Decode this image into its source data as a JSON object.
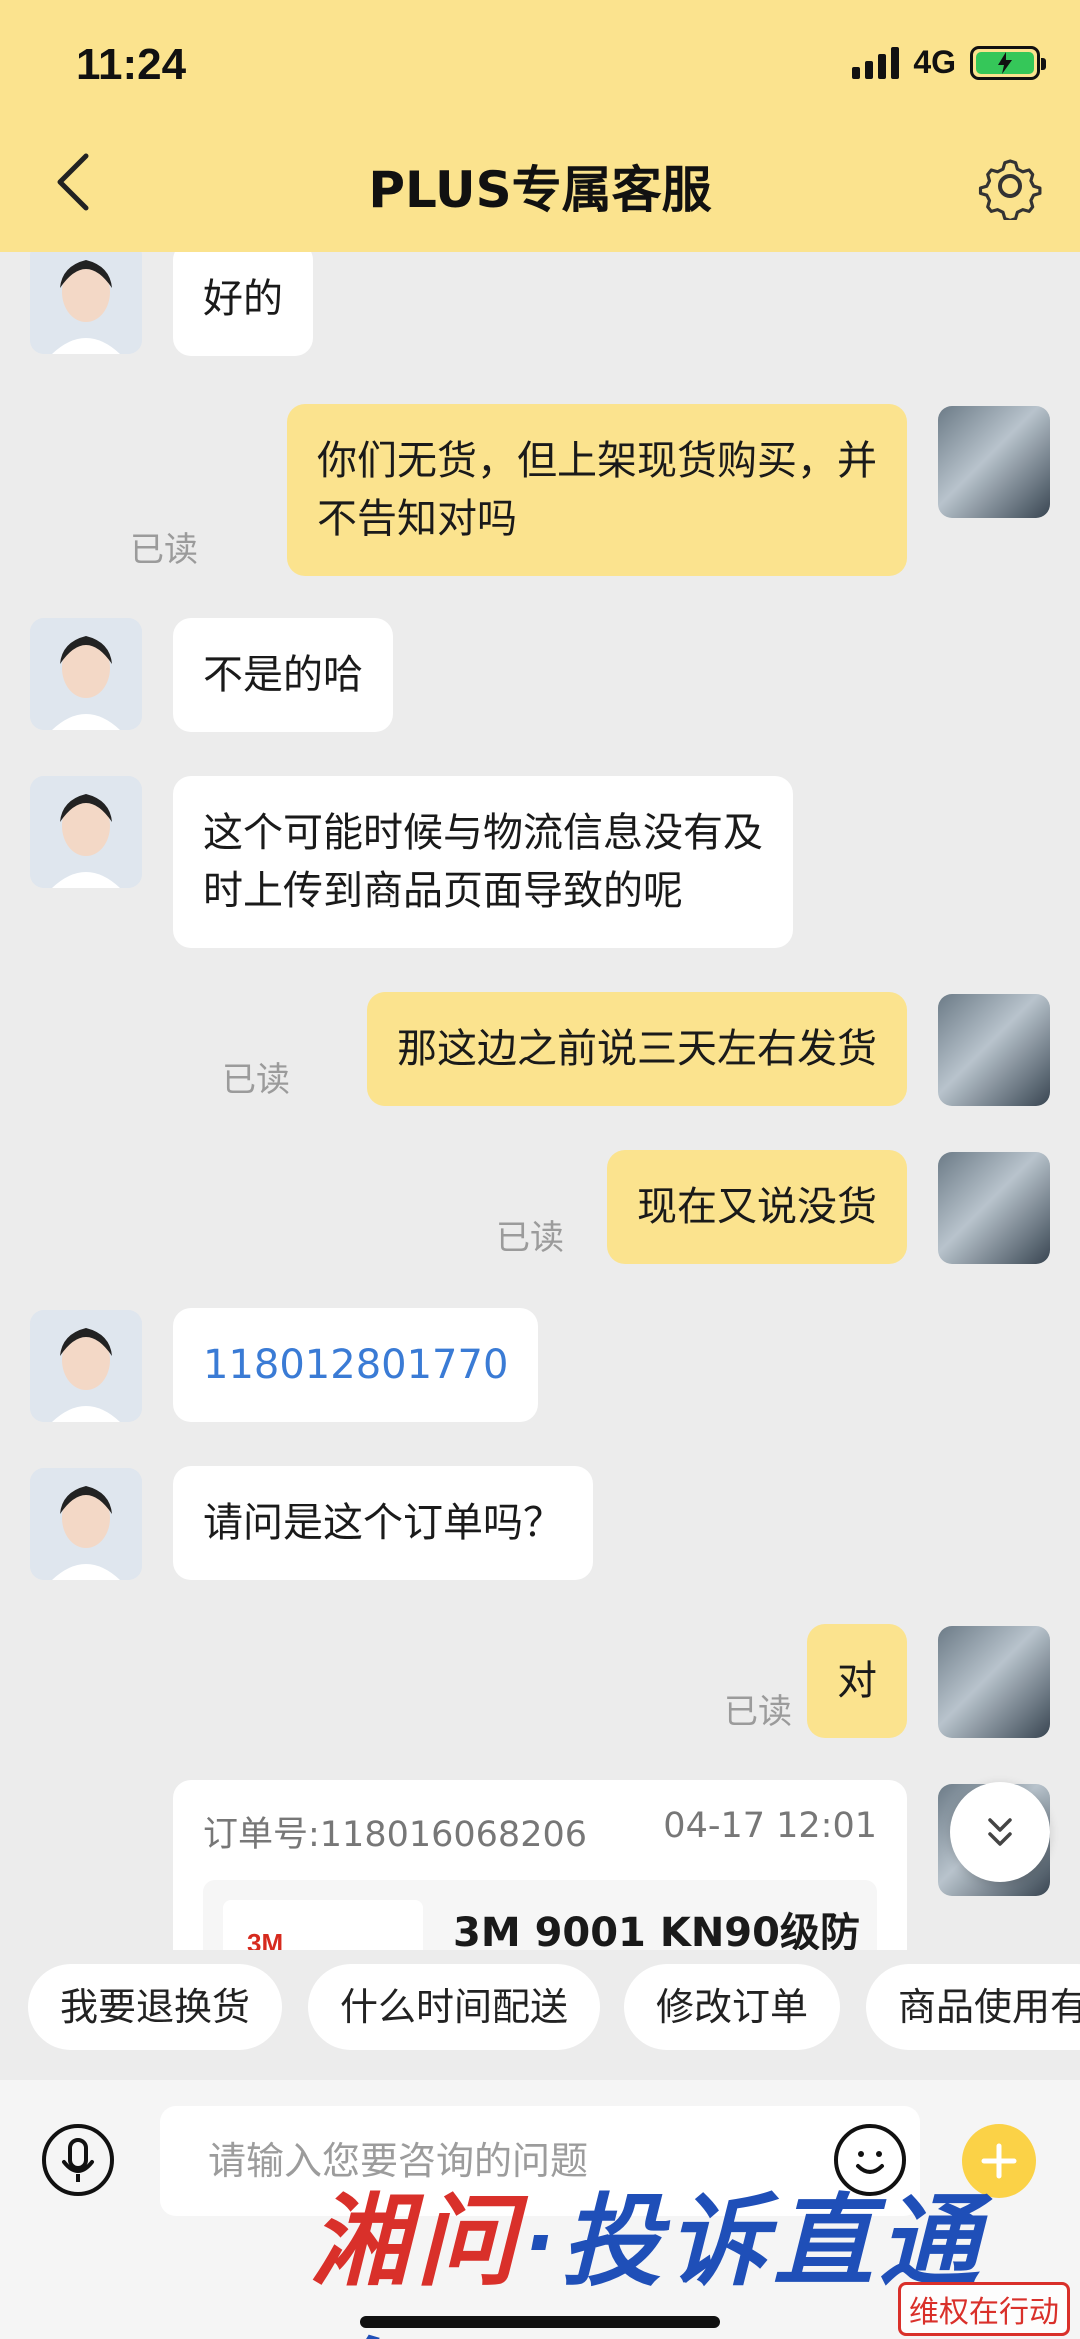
{
  "status_bar": {
    "time": "11:24",
    "network": "4G"
  },
  "header": {
    "title": "PLUS专属客服"
  },
  "messages": [
    {
      "from": "agent",
      "text": "好的"
    },
    {
      "from": "user",
      "lines": [
        "你们无货，但上架现货购买，并",
        "不告知对吗"
      ],
      "status": "已读"
    },
    {
      "from": "agent",
      "text": "不是的哈"
    },
    {
      "from": "agent",
      "lines": [
        "这个可能时候与物流信息没有及",
        "时上传到商品页面导致的呢"
      ]
    },
    {
      "from": "user",
      "text": "那这边之前说三天左右发货",
      "status": "已读"
    },
    {
      "from": "user",
      "text": "现在又说没货",
      "status": "已读"
    },
    {
      "from": "agent",
      "text": "118012801770"
    },
    {
      "from": "agent",
      "text": "请问是这个订单吗？"
    },
    {
      "from": "user",
      "text": "对",
      "status": "已读"
    }
  ],
  "order_card": {
    "order_no": "订单号:118016068206",
    "time": "04-17 12:01",
    "brand": "3M",
    "product_title": "3M 9001 KN90级防"
  },
  "quick_replies": [
    "我要退换货",
    "什么时间配送",
    "修改订单",
    "商品使用有"
  ],
  "input": {
    "placeholder": "请输入您要咨询的问题"
  },
  "watermark": {
    "left": "湘问",
    "right": "·投诉直通车",
    "stamp": "维权在行动"
  },
  "colors": {
    "header_bg": "#fbe38e",
    "user_bubble": "#fbe38e",
    "agent_bubble": "#ffffff",
    "link": "#3a7bd5",
    "plus_button": "#fbd247"
  }
}
